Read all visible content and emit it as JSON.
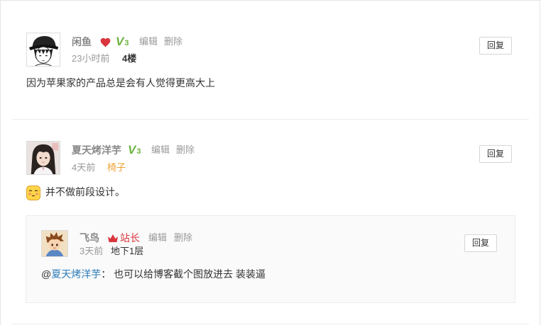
{
  "comments": [
    {
      "author": "闲鱼",
      "avatar_icon": "anime-boy-avatar",
      "badge_icon": "heart-icon",
      "level_prefix": "V",
      "level": "3",
      "edit": "编辑",
      "delete": "删除",
      "time": "23小时前",
      "floor": "4楼",
      "reply": "回复",
      "content": "因为苹果家的产品总是会有人觉得更高大上"
    },
    {
      "author": "夏天烤洋芋",
      "avatar_icon": "girl-photo-avatar",
      "level_prefix": "V",
      "level": "3",
      "edit": "编辑",
      "delete": "删除",
      "time": "4天前",
      "floor": "椅子",
      "reply": "回复",
      "emoji_icon": "shy-face-emoji-icon",
      "content": "并不做前段设计。",
      "replies": [
        {
          "author": "飞鸟",
          "avatar_icon": "cartoon-boy-avatar",
          "role_icon": "crown-icon",
          "role": "站长",
          "edit": "编辑",
          "delete": "删除",
          "time": "3天前",
          "floor": "地下1层",
          "reply": "回复",
          "mention_prefix": "@",
          "mention": "夏天烤洋芋",
          "content": "： 也可以给博客截个图放进去 装装逼"
        }
      ]
    }
  ],
  "colors": {
    "name": "#888888",
    "muted": "#999999",
    "text": "#333333",
    "level_badge": "#6db33f",
    "heart": "#d9363e",
    "admin": "#d9363e",
    "chair_floor": "#f0a030",
    "link": "#2b7bb9"
  }
}
